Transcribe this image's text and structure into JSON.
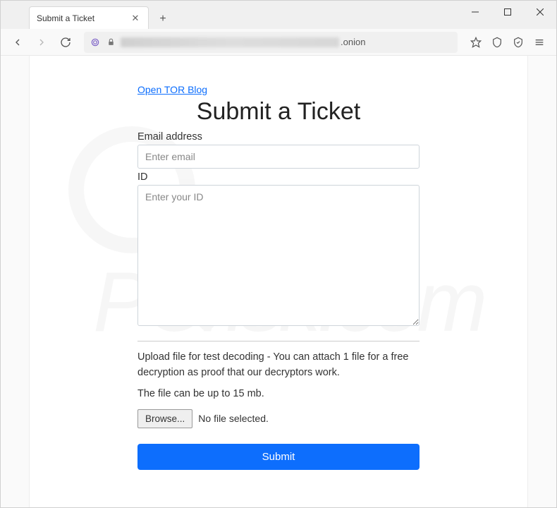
{
  "window": {
    "tab_title": "Submit a Ticket"
  },
  "address": {
    "suffix": ".onion"
  },
  "page": {
    "top_link": "Open TOR Blog",
    "title": "Submit a Ticket",
    "email_label": "Email address",
    "email_placeholder": "Enter email",
    "id_label": "ID",
    "id_placeholder": "Enter your ID",
    "upload_instructions": "Upload file for test decoding - You can attach 1 file for a free decryption as proof that our decryptors work.",
    "size_note": "The file can be up to 15 mb.",
    "browse_label": "Browse...",
    "file_status": "No file selected.",
    "submit_label": "Submit"
  },
  "watermark": {
    "text": "PCrisk.com"
  }
}
